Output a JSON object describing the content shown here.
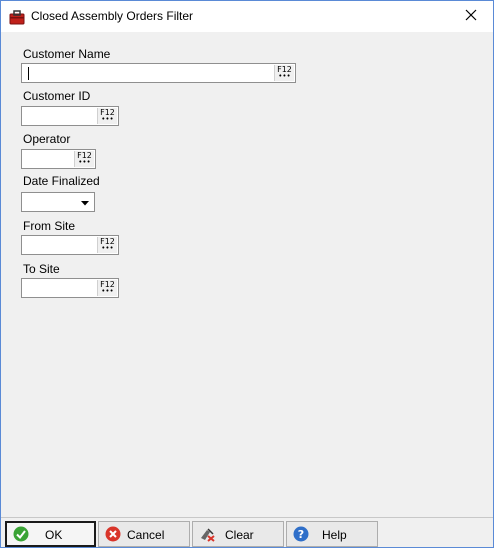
{
  "window": {
    "title": "Closed Assembly Orders Filter",
    "app_icon": "toolbox-icon",
    "close_icon": "close-icon"
  },
  "fields": {
    "customer_name": {
      "label": "Customer Name",
      "value": "",
      "lookup_key": "F12"
    },
    "customer_id": {
      "label": "Customer ID",
      "value": "",
      "lookup_key": "F12"
    },
    "operator": {
      "label": "Operator",
      "value": "",
      "lookup_key": "F12"
    },
    "date_finalized": {
      "label": "Date Finalized",
      "value": ""
    },
    "from_site": {
      "label": "From Site",
      "value": "",
      "lookup_key": "F12"
    },
    "to_site": {
      "label": "To Site",
      "value": "",
      "lookup_key": "F12"
    }
  },
  "buttons": {
    "ok": {
      "label": "OK",
      "icon": "checkmark-icon"
    },
    "cancel": {
      "label": "Cancel",
      "icon": "cancel-icon"
    },
    "clear": {
      "label": "Clear",
      "icon": "clear-icon"
    },
    "help": {
      "label": "Help",
      "icon": "help-icon"
    }
  },
  "colors": {
    "window_border": "#5a8ad6",
    "ok_green": "#3aa335",
    "cancel_red": "#d9352a",
    "help_blue": "#2f6fc9",
    "icon_red": "#c0201a"
  }
}
